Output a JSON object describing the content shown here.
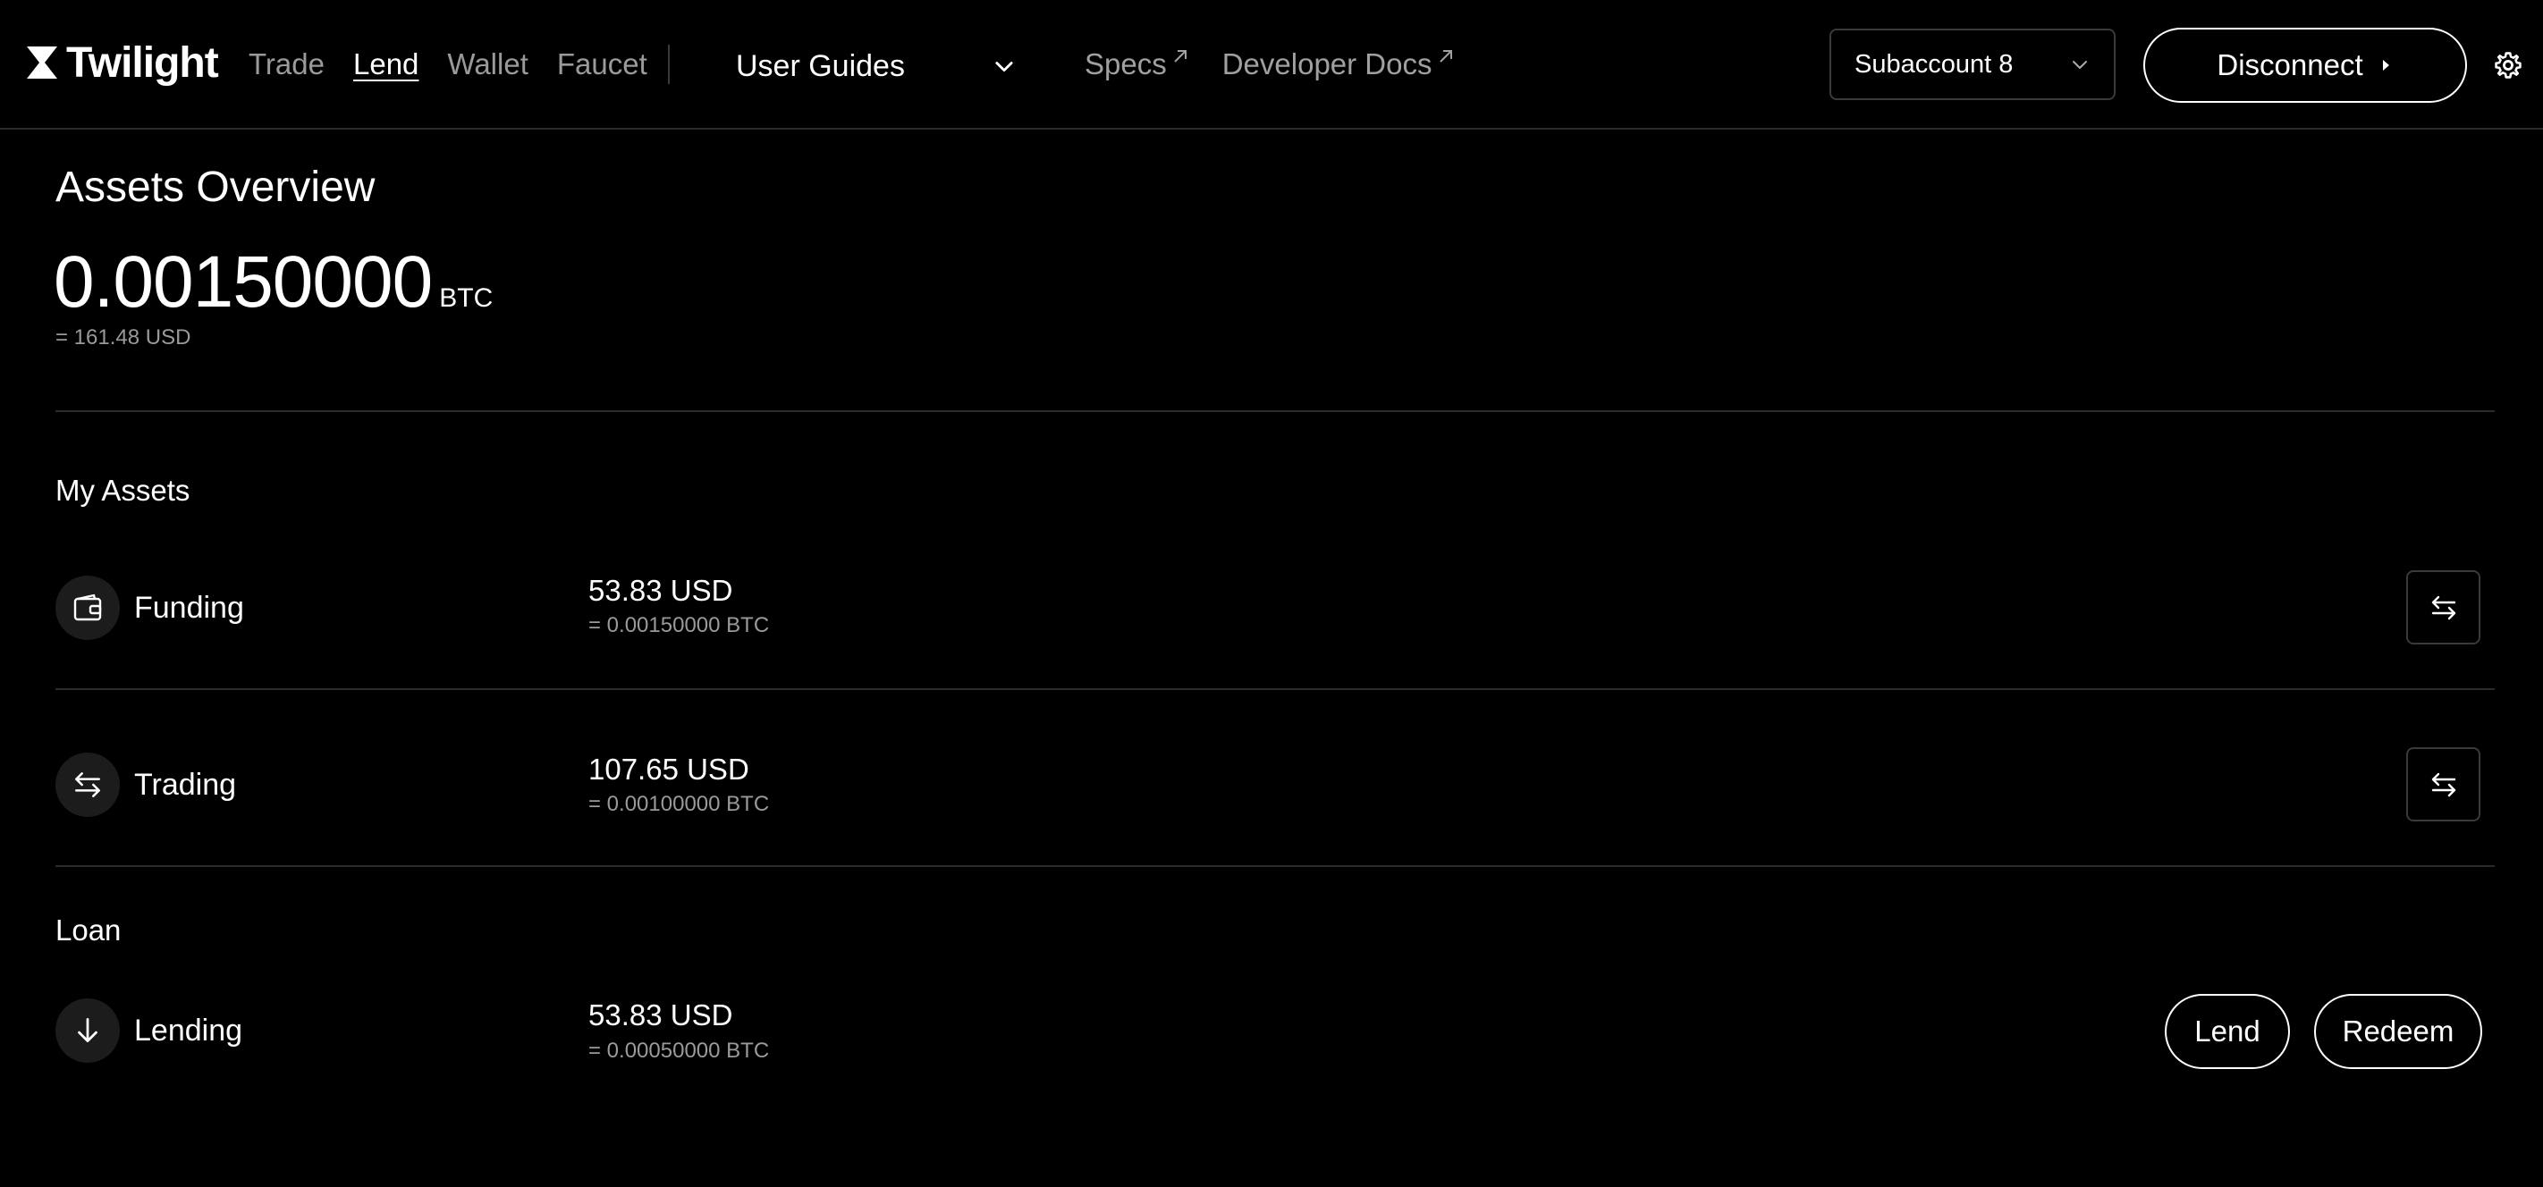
{
  "header": {
    "logo_text": "Twilight",
    "nav": [
      {
        "label": "Trade",
        "active": false
      },
      {
        "label": "Lend",
        "active": true
      },
      {
        "label": "Wallet",
        "active": false
      },
      {
        "label": "Faucet",
        "active": false
      }
    ],
    "guides_label": "User Guides",
    "external_links": [
      "Specs",
      "Developer Docs"
    ],
    "subaccount_label": "Subaccount 8",
    "disconnect_label": "Disconnect"
  },
  "overview": {
    "title": "Assets Overview",
    "balance_btc": "0.00150000",
    "balance_unit": "BTC",
    "balance_usd": "= 161.48 USD"
  },
  "my_assets": {
    "title": "My Assets",
    "rows": [
      {
        "label": "Funding",
        "icon": "wallet-icon",
        "usd": "53.83 USD",
        "btc": "= 0.00150000 BTC"
      },
      {
        "label": "Trading",
        "icon": "transfer-icon",
        "usd": "107.65 USD",
        "btc": "= 0.00100000 BTC"
      }
    ]
  },
  "loan": {
    "title": "Loan",
    "row": {
      "label": "Lending",
      "icon": "arrow-down-icon",
      "usd": "53.83 USD",
      "btc": "= 0.00050000 BTC"
    },
    "lend_label": "Lend",
    "redeem_label": "Redeem"
  },
  "colors": {
    "background": "#000000",
    "text": "#ffffff",
    "muted_text": "#9a9a9a",
    "divider": "#2b2b2b",
    "icon_bg": "#1c1c1c"
  }
}
